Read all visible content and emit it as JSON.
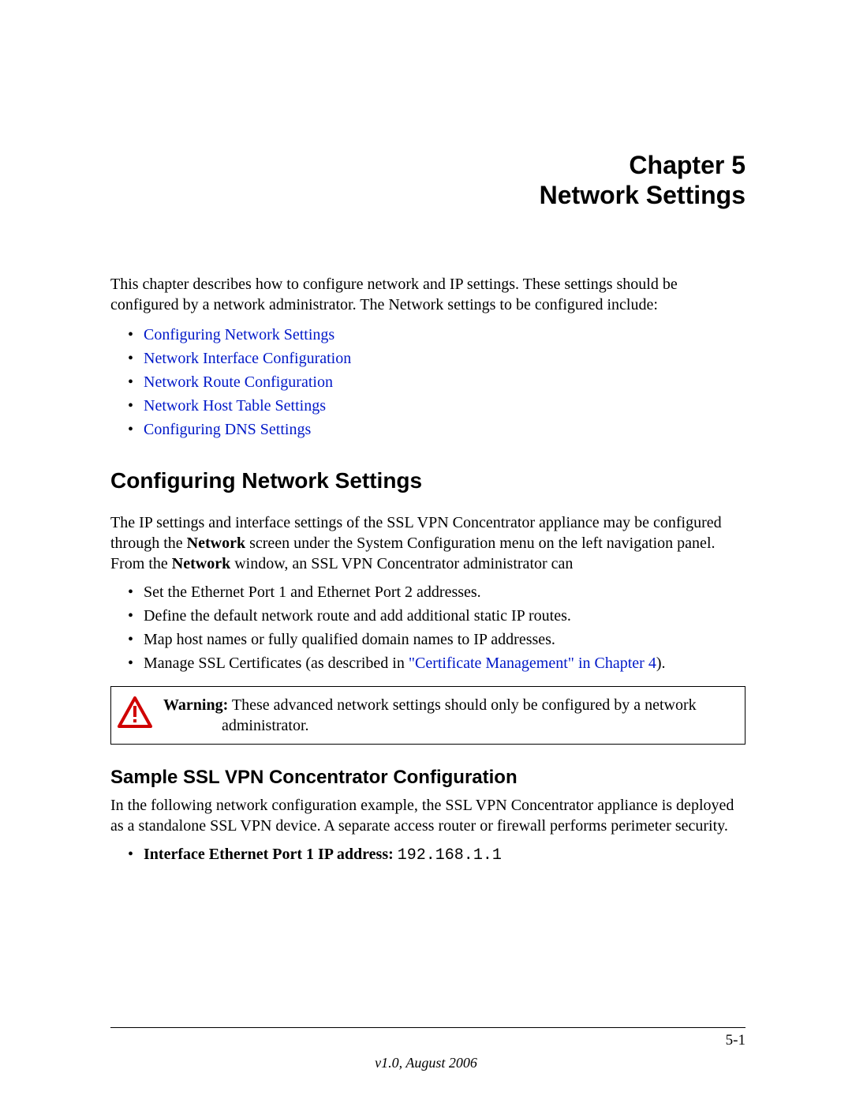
{
  "chapter": {
    "line1": "Chapter 5",
    "line2": "Network Settings"
  },
  "intro": "This chapter describes how to configure network and IP settings. These settings should be configured by a network administrator. The Network settings to be configured include:",
  "toc_links": [
    "Configuring Network Settings",
    "Network Interface Configuration",
    "Network Route Configuration",
    "Network Host Table Settings",
    "Configuring DNS Settings"
  ],
  "section1": {
    "heading": "Configuring Network Settings",
    "p1_a": "The IP settings and interface settings of the SSL VPN Concentrator appliance may be configured through the ",
    "p1_bold": "Network",
    "p1_b": " screen under the System Configuration menu on the left navigation panel. From the ",
    "p1_bold2": "Network",
    "p1_c": " window, an SSL VPN Concentrator administrator can",
    "bullets": [
      "Set the Ethernet Port 1 and Ethernet Port 2 addresses.",
      "Define the default network route and add additional static IP routes.",
      "Map host names or fully qualified domain names to IP addresses."
    ],
    "bullet4_a": "Manage SSL Certificates (as described in ",
    "bullet4_link": "\"Certificate Management\" in Chapter 4",
    "bullet4_b": ")."
  },
  "warning": {
    "label": "Warning:",
    "text_a": " These advanced network settings should only be configured by a network ",
    "text_b": "administrator."
  },
  "section2": {
    "heading": "Sample SSL VPN Concentrator Configuration",
    "p1": "In the following network configuration example, the SSL VPN Concentrator appliance is deployed as a standalone SSL VPN device. A separate access router or firewall performs perimeter security.",
    "bullet_bold": "Interface Ethernet Port 1 IP address: ",
    "bullet_mono": "192.168.1.1"
  },
  "footer": {
    "page": "5-1",
    "version": "v1.0, August 2006"
  }
}
